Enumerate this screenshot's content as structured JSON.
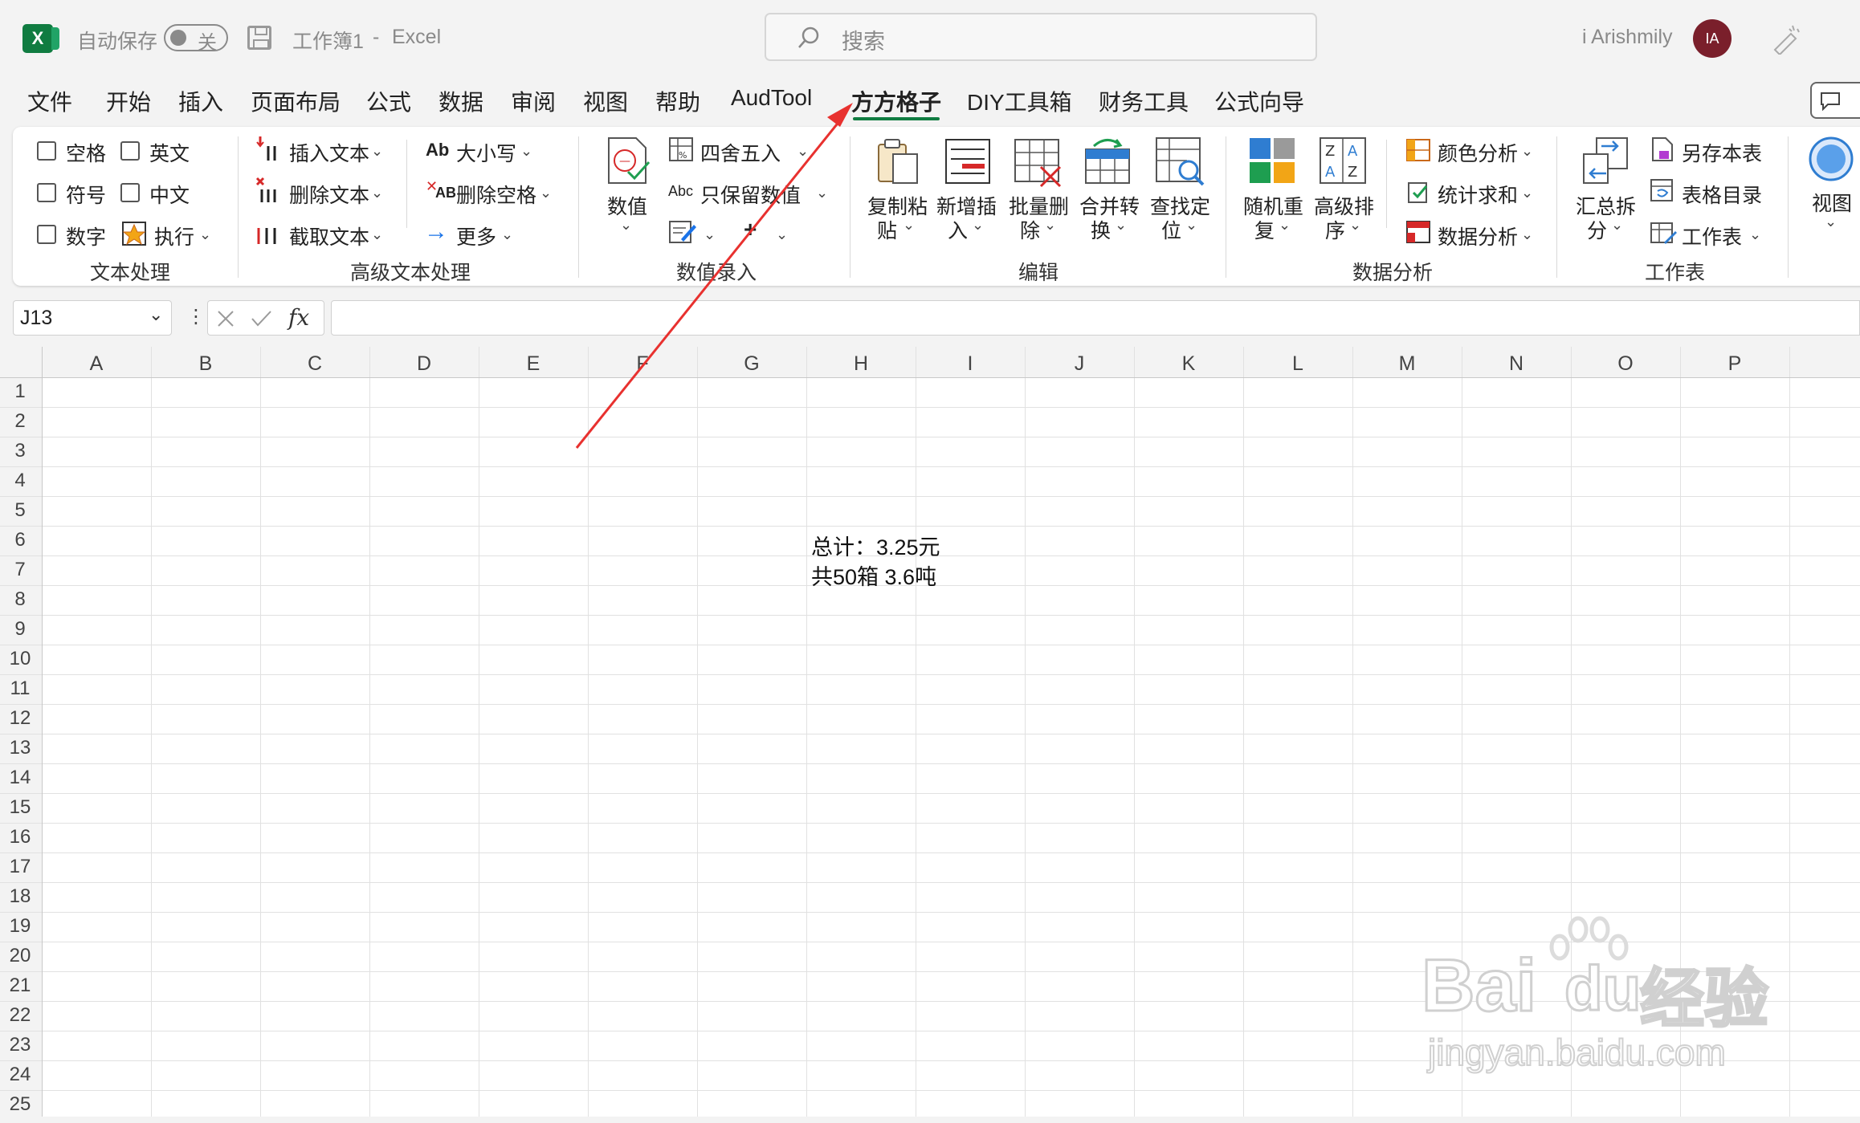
{
  "titlebar": {
    "autosave_label": "自动保存",
    "autosave_state": "关",
    "workbook_title": "工作簿1",
    "separator": "-",
    "app_name": "Excel",
    "search_placeholder": "搜索",
    "user_name": "i Arishmily",
    "user_initials": "IA",
    "excel_icon_letter": "X"
  },
  "menu": {
    "tabs": [
      "文件",
      "开始",
      "插入",
      "页面布局",
      "公式",
      "数据",
      "审阅",
      "视图",
      "帮助",
      "AudTool",
      "方方格子",
      "DIY工具箱",
      "财务工具",
      "公式向导"
    ],
    "active_index": 10
  },
  "ribbon": {
    "text_processing": {
      "checkboxes": [
        "空格",
        "英文",
        "符号",
        "中文",
        "数字"
      ],
      "execute": "执行",
      "group_label": "文本处理"
    },
    "advanced_text": {
      "insert_text": "插入文本",
      "delete_text": "删除文本",
      "extract_text": "截取文本",
      "case_glyph": "Ab",
      "case": "大小写",
      "del_space_glyph": "AB",
      "delete_space": "删除空格",
      "more": "更多",
      "group_label": "高级文本处理"
    },
    "numeric": {
      "value_big": "数值",
      "round": "四舍五入",
      "keep_glyph": "Abc",
      "keep_numeric": "只保留数值",
      "group_label": "数值录入"
    },
    "edit": {
      "buttons": [
        [
          "复制粘",
          "贴"
        ],
        [
          "新增插",
          "入"
        ],
        [
          "批量删",
          "除"
        ],
        [
          "合并转",
          "换"
        ],
        [
          "查找定",
          "位"
        ]
      ],
      "group_label": "编辑"
    },
    "analysis": {
      "random_repeat": [
        "随机重",
        "复"
      ],
      "advanced_sort": [
        "高级排",
        "序"
      ],
      "color_analysis": "颜色分析",
      "sum_stat": "统计求和",
      "data_analysis": "数据分析",
      "group_label": "数据分析"
    },
    "worksheet": {
      "summary_split": [
        "汇总拆",
        "分"
      ],
      "save_as": "另存本表",
      "catalog": "表格目录",
      "worksheet_btn": "工作表",
      "group_label": "工作表"
    },
    "view": {
      "label": "视图"
    }
  },
  "formula_bar": {
    "name_box": "J13",
    "fx_label": "fx",
    "formula_value": ""
  },
  "grid": {
    "columns": [
      "A",
      "B",
      "C",
      "D",
      "E",
      "F",
      "G",
      "H",
      "I",
      "J",
      "K",
      "L",
      "M",
      "N",
      "O",
      "P"
    ],
    "rows": [
      "1",
      "2",
      "3",
      "4",
      "5",
      "6",
      "7",
      "8",
      "9",
      "10",
      "11",
      "12",
      "13",
      "14",
      "15",
      "16",
      "17",
      "18",
      "19",
      "20",
      "21",
      "22",
      "23",
      "24",
      "25"
    ],
    "cell_h6": "总计：3.25元",
    "cell_h7": "共50箱 3.6吨"
  },
  "watermark": {
    "brand": "Bai",
    "brand2": "du",
    "cn": "经验",
    "url": "jingyan.baidu.com"
  },
  "colors": {
    "excel_green": "#107c41",
    "annotation_arrow": "#e8312f",
    "avatar": "#7a1f2b"
  }
}
